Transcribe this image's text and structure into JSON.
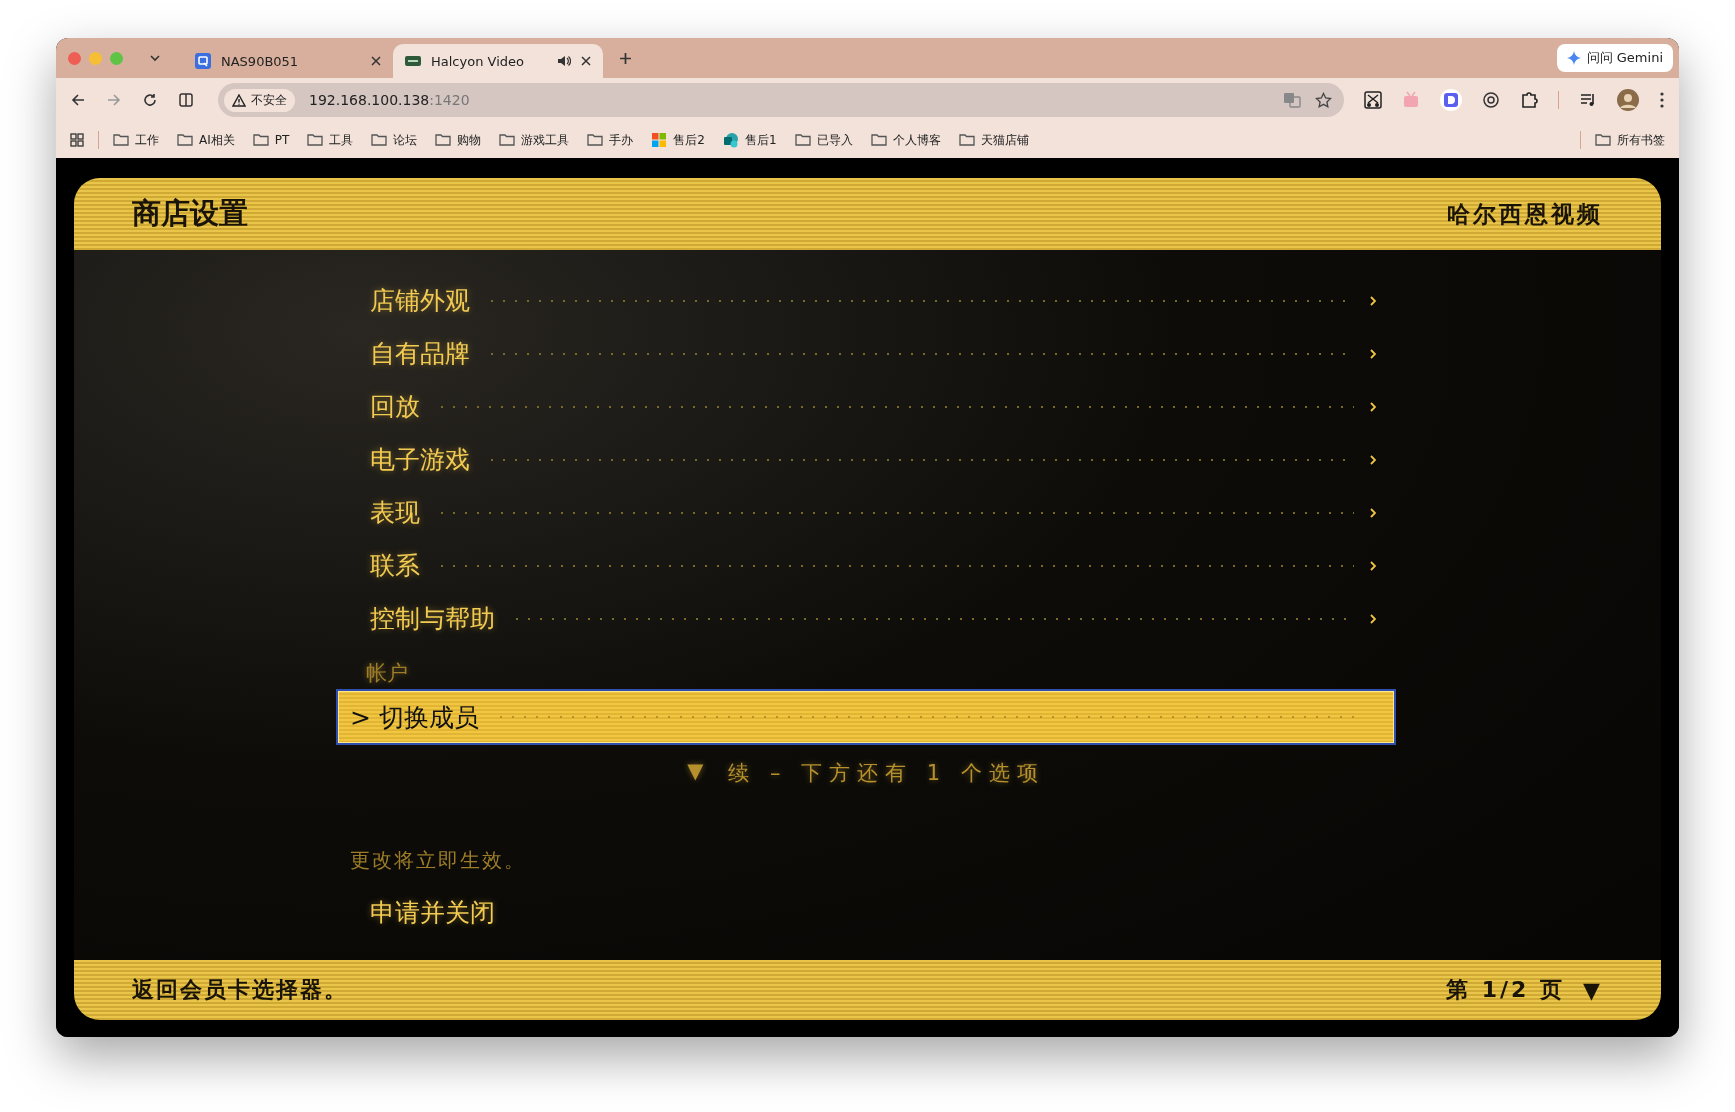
{
  "browser": {
    "tabs": [
      {
        "title": "NAS90B051",
        "selected": false,
        "audio": false
      },
      {
        "title": "Halcyon Video",
        "selected": true,
        "audio": true
      }
    ],
    "address": {
      "security": "不安全",
      "host": "192.168.100.138",
      "port": ":1420"
    },
    "gemini_button": "问问 Gemini",
    "bookmarks": [
      {
        "label": "工作",
        "kind": "folder"
      },
      {
        "label": "AI相关",
        "kind": "folder"
      },
      {
        "label": "PT",
        "kind": "folder"
      },
      {
        "label": "工具",
        "kind": "folder"
      },
      {
        "label": "论坛",
        "kind": "folder"
      },
      {
        "label": "购物",
        "kind": "folder"
      },
      {
        "label": "游戏工具",
        "kind": "folder"
      },
      {
        "label": "手办",
        "kind": "folder"
      },
      {
        "label": "售后2",
        "kind": "tiles"
      },
      {
        "label": "售后1",
        "kind": "app"
      },
      {
        "label": "已导入",
        "kind": "folder"
      },
      {
        "label": "个人博客",
        "kind": "folder"
      },
      {
        "label": "天猫店铺",
        "kind": "folder"
      }
    ],
    "all_bookmarks": "所有书签"
  },
  "app": {
    "title": "商店设置",
    "brand": "哈尔西恩视频",
    "cursor": ">",
    "menu": [
      {
        "kind": "item",
        "label": "店铺外观",
        "selected": false
      },
      {
        "kind": "item",
        "label": "自有品牌",
        "selected": false
      },
      {
        "kind": "item",
        "label": "回放",
        "selected": false
      },
      {
        "kind": "item",
        "label": "电子游戏",
        "selected": false
      },
      {
        "kind": "item",
        "label": "表现",
        "selected": false
      },
      {
        "kind": "item",
        "label": "联系",
        "selected": false
      },
      {
        "kind": "item",
        "label": "控制与帮助",
        "selected": false
      },
      {
        "kind": "section",
        "label": "帐户"
      },
      {
        "kind": "item",
        "label": "切换成员",
        "selected": true
      }
    ],
    "more": {
      "arrow": "▼",
      "text": "续 – 下方还有 1 个选项"
    },
    "note": "更改将立即生效。",
    "apply_button": "申请并关闭",
    "footer": {
      "hint": "返回会员卡选择器。",
      "page": "第 1/2 页",
      "page_arrow": "▼"
    }
  }
}
